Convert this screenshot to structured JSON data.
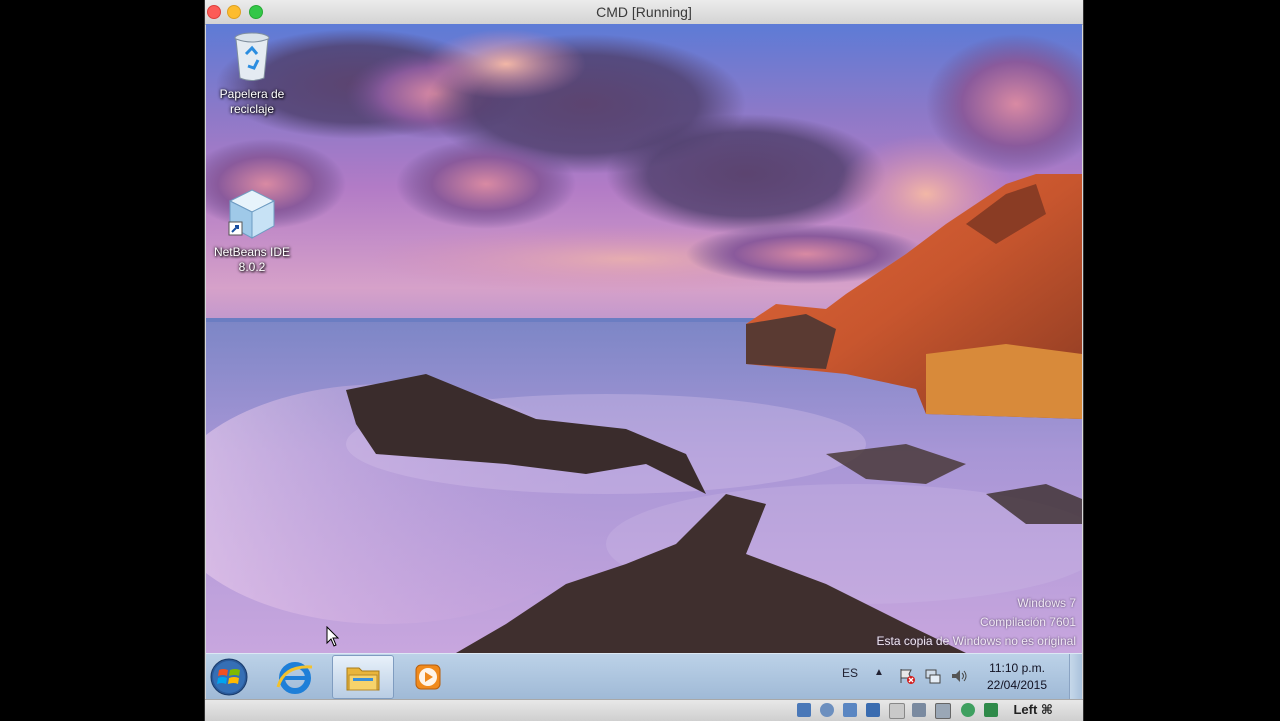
{
  "window": {
    "title": "CMD [Running]"
  },
  "desktop": {
    "icons": [
      {
        "label": "Papelera de reciclaje",
        "icon": "recycle-bin-icon"
      },
      {
        "label": "NetBeans IDE 8.0.2",
        "icon": "netbeans-cube-icon"
      }
    ],
    "watermark": {
      "line1": "Windows 7",
      "line2": "Compilación 7601",
      "line3": "Esta copia de Windows no es original"
    }
  },
  "taskbar": {
    "apps": [
      "start-orb-icon",
      "internet-explorer-icon",
      "windows-explorer-icon",
      "media-player-icon"
    ],
    "language": "ES",
    "tray_arrow": "▲",
    "clock": {
      "time": "11:10 p.m.",
      "date": "22/04/2015"
    }
  },
  "statusbar": {
    "host_key": "Left ⌘",
    "icons": [
      "hard-disk-icon",
      "optical-drive-icon",
      "network-icon",
      "usb-icon",
      "shared-folder-icon",
      "display-icon",
      "video-capture-icon",
      "guest-additions-icon",
      "mouse-integration-icon"
    ]
  },
  "colors": {
    "close": "#fc5b57",
    "minimize": "#fdbc2e",
    "maximize": "#33c748",
    "taskbar": "#a8c0da"
  }
}
